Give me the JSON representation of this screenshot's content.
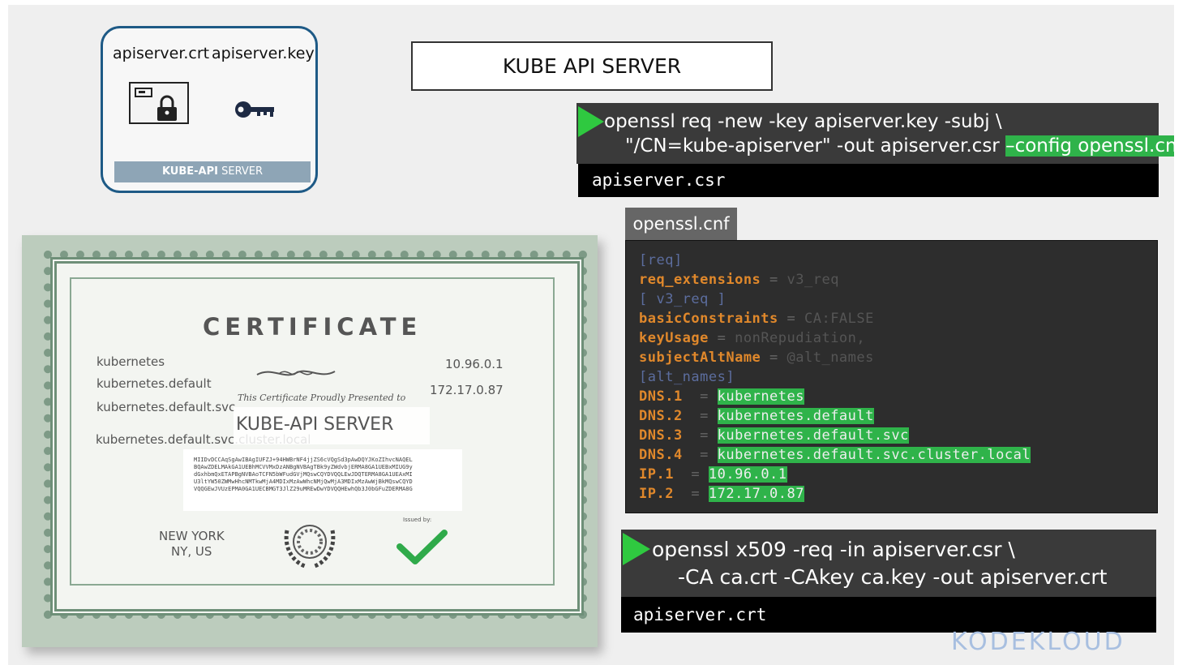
{
  "server_card": {
    "crt_label": "apiserver.crt",
    "key_label": "apiserver.key",
    "footer_bold": "KUBE-API",
    "footer_rest": " SERVER"
  },
  "title": "KUBE API SERVER",
  "cmd1": {
    "line1": "openssl req -new -key apiserver.key -subj \\",
    "line2_pre": "\"/CN=kube-apiserver\" -out apiserver.csr ",
    "line2_hl": "–config openssl.cnf",
    "output": "apiserver.csr"
  },
  "cnf": {
    "tab": "openssl.cnf",
    "lines": {
      "l1": "[req]",
      "l2_k": "req_extensions",
      "l2_v": "v3_req",
      "l3": "[ v3_req ]",
      "l4_k": "basicConstraints",
      "l4_v": "CA:FALSE",
      "l5_k": "keyUsage",
      "l5_v": "nonRepudiation,",
      "l6_k": "subjectAltName",
      "l6_v": "@alt_names",
      "l7": "[alt_names]",
      "dns1_k": "DNS.1",
      "dns1_v": "kubernetes",
      "dns2_k": "DNS.2",
      "dns2_v": "kubernetes.default",
      "dns3_k": "DNS.3",
      "dns3_v": "kubernetes.default.svc",
      "dns4_k": "DNS.4",
      "dns4_v": "kubernetes.default.svc.cluster.local",
      "ip1_k": "IP.1",
      "ip1_v": "10.96.0.1",
      "ip2_k": "IP.2",
      "ip2_v": "172.17.0.87"
    }
  },
  "cmd2": {
    "line1": "openssl x509 -req -in apiserver.csr \\",
    "line2": "-CA ca.crt -CAkey ca.key -out apiserver.crt",
    "output": "apiserver.crt"
  },
  "certificate": {
    "title": "CERTIFICATE",
    "names": [
      "kubernetes",
      "kubernetes.default",
      "kubernetes.default.svc",
      "kubernetes.default.svc.cluster.local"
    ],
    "ips": [
      "10.96.0.1",
      "172.17.0.87"
    ],
    "presented": "This Certificate Proudly Presented to",
    "subject": "KUBE-API SERVER",
    "hash_lines": [
      "MIIDvDCCAqSgAwIBAgIUFZJ+94HWBrNF4jjZS6cVQgSd3pAwDQYJKoZIhvcNAQEL",
      "BQAwZDELMAkGA1UEBhMCVVMxDzANBgNVBAgTBk9yZWdvbjERMA8GA1UEBxMIUG9y",
      "dGxhbmQxETAPBgNVBAoTCFN5bWFudGVjMQswCQYDVQQLEwJDQTERMA8GA1UEAxMI",
      "U3ltYW50ZWMwHhcNMTkwMjA4MDIxMzAwWhcNMjQwMjA3MDIxMzAwWjBkMQswCQYD",
      "VQQGEwJVUzEPMA0GA1UECBMGT3JlZ29uMREwDwYDVQQHEwhQb3J0bGFuZDERMA8G"
    ],
    "location1": "NEW YORK",
    "location2": "NY, US",
    "issued_by": "Issued by:"
  },
  "logo": "KODEKLOUD"
}
